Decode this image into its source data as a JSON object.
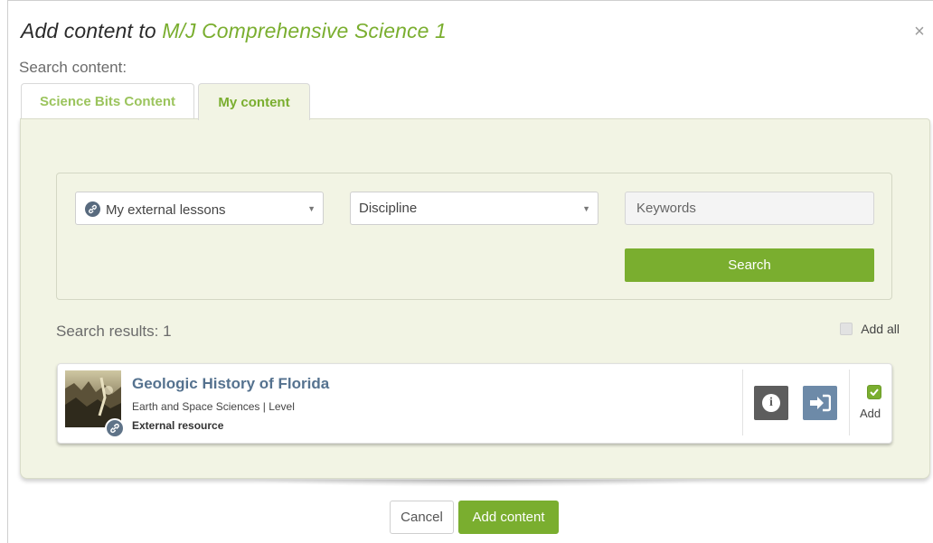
{
  "dialog": {
    "title_prefix": "Add content to ",
    "title_course": "M/J Comprehensive Science 1",
    "close_glyph": "×",
    "close_icon": "close-icon"
  },
  "search_label": "Search content:",
  "tabs": [
    {
      "label": "Science Bits Content",
      "active": false
    },
    {
      "label": "My content",
      "active": true
    }
  ],
  "filters": {
    "lessons_select": {
      "value": "My external lessons",
      "icon": "link-icon"
    },
    "discipline_select": {
      "value": "Discipline"
    },
    "keywords_placeholder": "Keywords",
    "search_button": "Search"
  },
  "results": {
    "label": "Search results: 1",
    "add_all_label": "Add all",
    "add_all_checked": false,
    "items": [
      {
        "title": "Geologic History of Florida",
        "subtitle": "Earth and Space Sciences | Level",
        "type": "External resource",
        "thumbnail": "geology-thumbnail",
        "badge_icon": "link-icon",
        "actions": [
          "info-icon",
          "open-icon"
        ],
        "add_label": "Add",
        "add_checked": true
      }
    ]
  },
  "footer": {
    "cancel": "Cancel",
    "add_content": "Add content"
  },
  "colors": {
    "accent": "#7aae2f",
    "panel_bg": "#f2f4e4",
    "title_link": "#55728f",
    "info_button": "#5d5d5d",
    "open_button": "#6d8aa8"
  }
}
